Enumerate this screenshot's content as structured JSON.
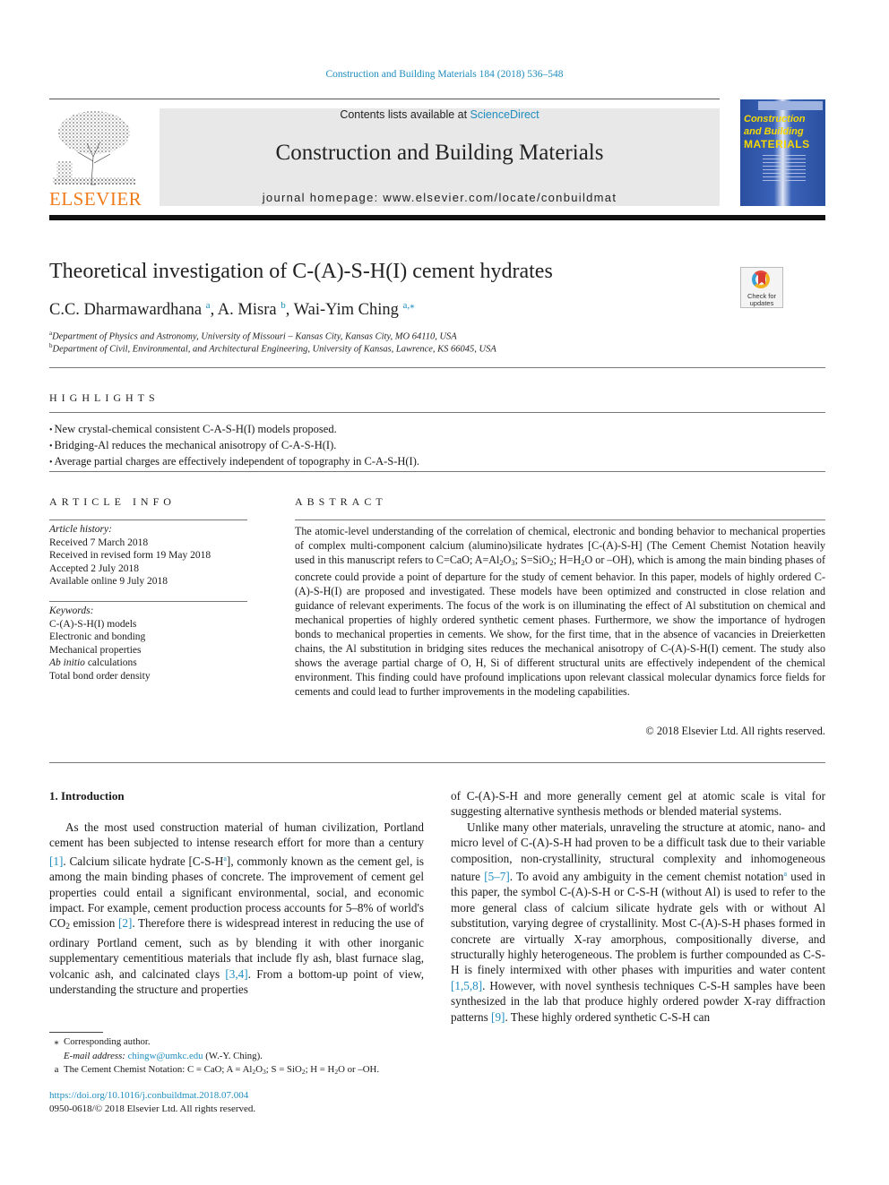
{
  "header": {
    "journal_reference": "Construction and Building Materials 184 (2018) 536–548",
    "contents_prefix": "Contents lists available at ",
    "contents_link": "ScienceDirect",
    "journal_title": "Construction and Building Materials",
    "homepage": "journal homepage: www.elsevier.com/locate/conbuildmat",
    "publisher_logo_text": "ELSEVIER",
    "cover": {
      "line1": "Construction",
      "line2": "and Building",
      "line3": "MATERIALS"
    },
    "check_updates": {
      "line1": "Check for",
      "line2": "updates"
    }
  },
  "article": {
    "title": "Theoretical investigation of C-(A)-S-H(I) cement hydrates",
    "authors": [
      {
        "name": "C.C. Dharmawardhana",
        "aff": "a"
      },
      {
        "name": "A. Misra",
        "aff": "b"
      },
      {
        "name": "Wai-Yim Ching",
        "aff": "a,⁎"
      }
    ],
    "affiliations": [
      {
        "mark": "a",
        "text": "Department of Physics and Astronomy, University of Missouri – Kansas City, Kansas City, MO 64110, USA"
      },
      {
        "mark": "b",
        "text": "Department of Civil, Environmental, and Architectural Engineering, University of Kansas, Lawrence, KS 66045, USA"
      }
    ]
  },
  "highlights": {
    "heading": "HIGHLIGHTS",
    "items": [
      "New crystal-chemical consistent C-A-S-H(I) models proposed.",
      "Bridging-Al reduces the mechanical anisotropy of C-A-S-H(I).",
      "Average partial charges are effectively independent of topography in C-A-S-H(I)."
    ]
  },
  "article_info": {
    "heading": "ARTICLE INFO",
    "history_label": "Article history:",
    "history": [
      "Received 7 March 2018",
      "Received in revised form 19 May 2018",
      "Accepted 2 July 2018",
      "Available online 9 July 2018"
    ],
    "keywords_label": "Keywords:",
    "keywords": [
      "C-(A)-S-H(I) models",
      "Electronic and bonding",
      "Mechanical properties",
      "Ab initio",
      "Total bond order density"
    ],
    "keyword4_suffix": " calculations"
  },
  "abstract": {
    "heading": "ABSTRACT",
    "p1": "The atomic-level understanding of the correlation of chemical, electronic and bonding behavior to mechanical properties of complex multi-component calcium (alumino)silicate hydrates [C-(A)-S-H] (The Cement Chemist Notation heavily used in this manuscript refers to C=CaO; A=Al",
    "p2": "O",
    "p3": "; S=SiO",
    "p4": "; H=H",
    "p5": "O or –OH), which is among the main binding phases of concrete could provide a point of departure for the study of cement behavior. In this paper, models of highly ordered C-(A)-S-H(I) are proposed and investigated. These models have been optimized and constructed in close relation and guidance of relevant experiments. The focus of the work is on illuminating the effect of Al substitution on chemical and mechanical properties of highly ordered synthetic cement phases. Furthermore, we show the importance of hydrogen bonds to mechanical properties in cements. We show, for the first time, that in the absence of vacancies in Dreierketten chains, the Al substitution in bridging sites reduces the mechanical anisotropy of C-(A)-S-H(I) cement. The study also shows the average partial charge of O, H, Si of different structural units are effectively independent of the chemical environment. This finding could have profound implications upon relevant classical molecular dynamics force fields for cements and could lead to further improvements in the modeling capabilities.",
    "copyright": "© 2018 Elsevier Ltd. All rights reserved."
  },
  "introduction": {
    "heading": "1. Introduction",
    "left_p1_a": "As the most used construction material of human civilization, Portland cement has been subjected to intense research effort for more than a century ",
    "ref1": "[1]",
    "left_p1_b": ". Calcium silicate hydrate [C-S-H",
    "fn_a": "a",
    "left_p1_c": "], commonly known as the cement gel, is among the main binding phases of concrete. The improvement of cement gel properties could entail a significant environmental, social, and economic impact. For example, cement production process accounts for 5–8% of world's CO",
    "left_p1_d": " emission ",
    "ref2": "[2]",
    "left_p1_e": ". Therefore there is widespread interest in reducing the use of ordinary Portland cement, such as by blending it with other inorganic supplementary cementitious materials that include fly ash, blast furnace slag, volcanic ash, and calcinated clays ",
    "ref3": "[3,4]",
    "left_p1_f": ". From a bottom-up point of view, understanding the structure and properties",
    "right_p1": "of C-(A)-S-H and more generally cement gel at atomic scale is vital for suggesting alternative synthesis methods or blended material systems.",
    "right_p2_a": "Unlike many other materials, unraveling the structure at atomic, nano- and micro level of C-(A)-S-H had proven to be a difficult task due to their variable composition, non-crystallinity, structural complexity and inhomogeneous nature ",
    "ref4": "[5–7]",
    "right_p2_b": ". To avoid any ambiguity in the cement chemist notation",
    "right_p2_c": " used in this paper, the symbol C-(A)-S-H or C-S-H (without Al) is used to refer to the more general class of calcium silicate hydrate gels with or without Al substitution, varying degree of crystallinity. Most C-(A)-S-H phases formed in concrete are virtually X-ray amorphous, compositionally diverse, and structurally highly heterogeneous. The problem is further compounded as C-S-H is finely intermixed with other phases with impurities and water content ",
    "ref5": "[1,5,8]",
    "right_p2_d": ". However, with novel synthesis techniques C-S-H samples have been synthesized in the lab that produce highly ordered powder X-ray diffraction patterns ",
    "ref6": "[9]",
    "right_p2_e": ". These highly ordered synthetic C-S-H can"
  },
  "footnotes": {
    "corresponding_mark": "⁎",
    "corresponding": "Corresponding author.",
    "email_label": "E-mail address:",
    "email": "chingw@umkc.edu",
    "email_suffix": " (W.-Y. Ching).",
    "notation_mark": "a",
    "notation_a": "The Cement Chemist Notation: C = CaO; A = Al",
    "notation_b": "O",
    "notation_c": "; S = SiO",
    "notation_d": "; H = H",
    "notation_e": "O or –OH.",
    "doi": "https://doi.org/10.1016/j.conbuildmat.2018.07.004",
    "issn": "0950-0618/© 2018 Elsevier Ltd. All rights reserved."
  },
  "subscripts": {
    "two": "2",
    "three": "3"
  },
  "colors": {
    "link": "#1f8dbf",
    "elsevier_orange": "#f07b1b",
    "masthead_gray": "#e8e8e8",
    "cover_blue": "#2a4fa0",
    "cover_yellow": "#f5d800"
  }
}
